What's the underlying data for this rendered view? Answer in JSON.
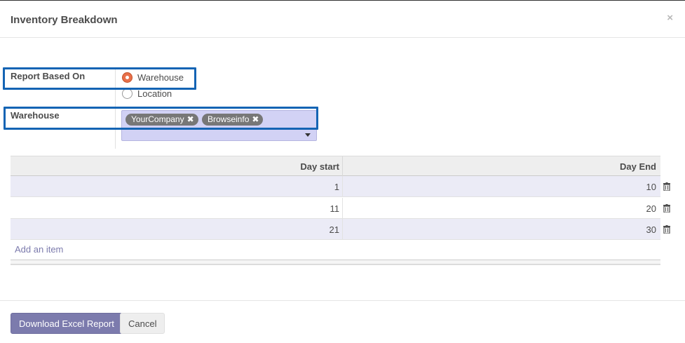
{
  "dialog": {
    "title": "Inventory Breakdown",
    "close_glyph": "×"
  },
  "form": {
    "report_based_on": {
      "label": "Report Based On",
      "options": [
        {
          "label": "Warehouse",
          "checked": true
        },
        {
          "label": "Location",
          "checked": false
        }
      ]
    },
    "warehouse": {
      "label": "Warehouse",
      "tags": [
        "YourCompany",
        "Browseinfo"
      ],
      "tag_remove_glyph": "✖"
    }
  },
  "table": {
    "columns": [
      "Day start",
      "Day End"
    ],
    "rows": [
      {
        "day_start": "1",
        "day_end": "10"
      },
      {
        "day_start": "11",
        "day_end": "20"
      },
      {
        "day_start": "21",
        "day_end": "30"
      }
    ],
    "add_item_label": "Add an item"
  },
  "footer": {
    "primary_label": "Download Excel Report",
    "cancel_label": "Cancel"
  },
  "colors": {
    "accent": "#7c7bad",
    "highlight_box": "#1464b4",
    "radio_checked": "#e8704a",
    "tag_bg": "#777777",
    "many2many_bg": "#d2d2f5",
    "row_odd_bg": "#ebebf6"
  },
  "icons": {
    "close": "close-icon",
    "tag_remove": "remove-icon",
    "dropdown": "caret-down-icon",
    "row_delete": "trash-icon"
  }
}
